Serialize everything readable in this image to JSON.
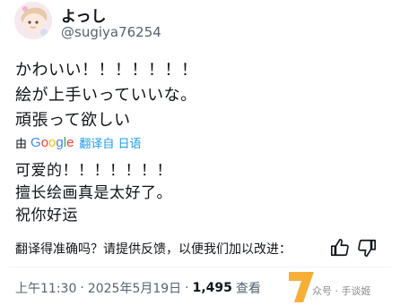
{
  "user": {
    "display_name": "よっし",
    "handle": "@sugiya76254"
  },
  "tweet": {
    "lines": [
      "かわいい！！！！！！！",
      "絵が上手いっていいな。",
      "頑張って欲しい"
    ]
  },
  "translation": {
    "by_label": "由",
    "provider": "Google",
    "link_label": "翻译自 日语",
    "lines": [
      "可爱的！！！！！！！",
      "擅长绘画真是太好了。",
      "祝你好运"
    ],
    "feedback_prompt": "翻译得准确吗？请提供反馈，以便我们加以改进："
  },
  "meta": {
    "time": "上午11:30",
    "separator": "·",
    "date": "2025年5月19日",
    "views_count": "1,495",
    "views_label": "查看"
  },
  "watermark": {
    "text": "众号 · 手谈姬"
  },
  "colors": {
    "link": "#1d9bf0",
    "secondary_text": "#536471",
    "primary_text": "#0f1419"
  }
}
